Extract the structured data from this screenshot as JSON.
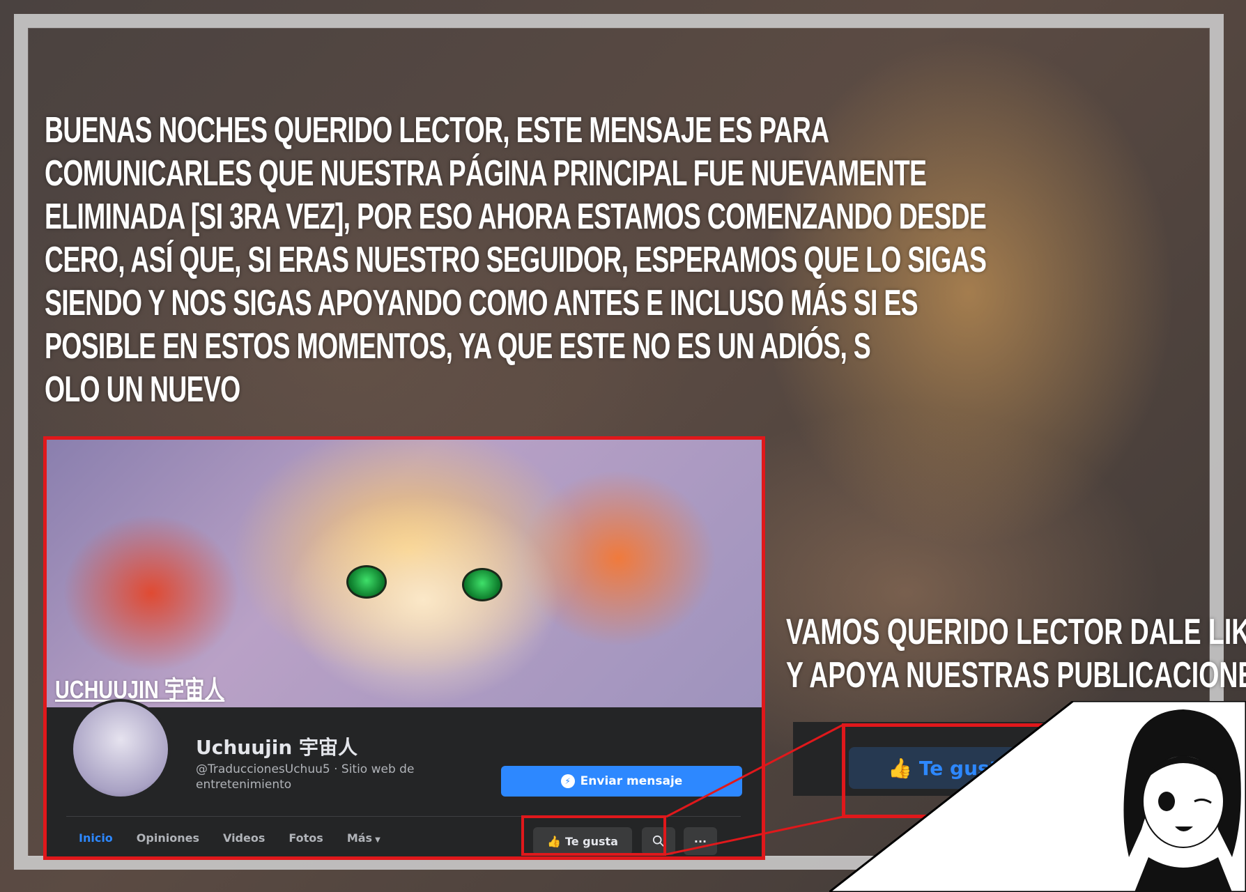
{
  "headline_lines": [
    "BUENAS NOCHES QUERIDO LECTOR, ESTE MENSAJE ES PARA",
    "COMUNICARLES QUE NUESTRA PÁGINA PRINCIPAL FUE NUEVAMENTE",
    "ELIMINADA [SI 3RA VEZ], POR ESO AHORA ESTAMOS COMENZANDO DESDE",
    "CERO, ASÍ QUE, SI ERAS NUESTRO SEGUIDOR, ESPERAMOS QUE LO SIGAS",
    "SIENDO Y NOS SIGAS APOYANDO COMO ANTES E INCLUSO MÁS SI ES",
    "POSIBLE EN ESTOS MOMENTOS, YA QUE ESTE NO ES UN ADIÓS, S",
    "OLO UN NUEVO"
  ],
  "side_text": {
    "line1": "VAMOS QUERIDO LECTOR DALE LIKE",
    "line2": "Y APOYA NUESTRAS PUBLICACIONES."
  },
  "fb_page": {
    "cover_watermark": "UCHUUJIN 宇宙人",
    "name": "Uchuujin 宇宙人",
    "handle": "@TraduccionesUchuu5 · Sitio web de entretenimiento",
    "message_button": "Enviar mensaje",
    "tabs": [
      {
        "label": "Inicio",
        "active": true
      },
      {
        "label": "Opiniones",
        "active": false
      },
      {
        "label": "Videos",
        "active": false
      },
      {
        "label": "Fotos",
        "active": false
      },
      {
        "label": "Más",
        "active": false
      }
    ],
    "like_button": "Te gusta",
    "search_icon": "search-icon",
    "more_icon": "more-icon"
  },
  "zoom": {
    "like_button": "Te gusta"
  },
  "colors": {
    "highlight_red": "#e0181b",
    "facebook_blue": "#2d88ff",
    "fb_dark": "#242526"
  }
}
